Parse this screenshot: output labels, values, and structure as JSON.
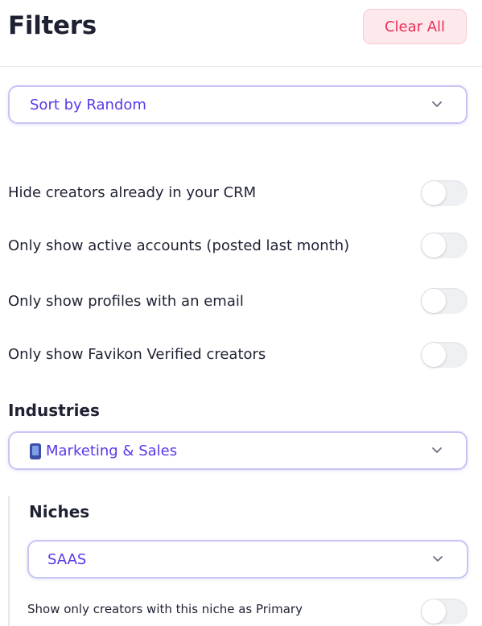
{
  "header": {
    "title": "Filters",
    "clear_all": "Clear All"
  },
  "sort": {
    "value": "Sort by Random"
  },
  "toggles": [
    {
      "label": "Hide creators already in your CRM"
    },
    {
      "label": "Only show active accounts (posted last month)"
    },
    {
      "label": "Only show profiles with an email"
    },
    {
      "label": "Only show Favikon Verified creators"
    }
  ],
  "industries": {
    "title": "Industries",
    "value": "Marketing & Sales",
    "icon": "phone-icon"
  },
  "niches": {
    "title": "Niches",
    "value": "SAAS",
    "primary_toggle": "Show only creators with this niche as Primary"
  },
  "colors": {
    "accent": "#5b37e8",
    "danger": "#eb2d57",
    "border": "#c7c5f4"
  }
}
